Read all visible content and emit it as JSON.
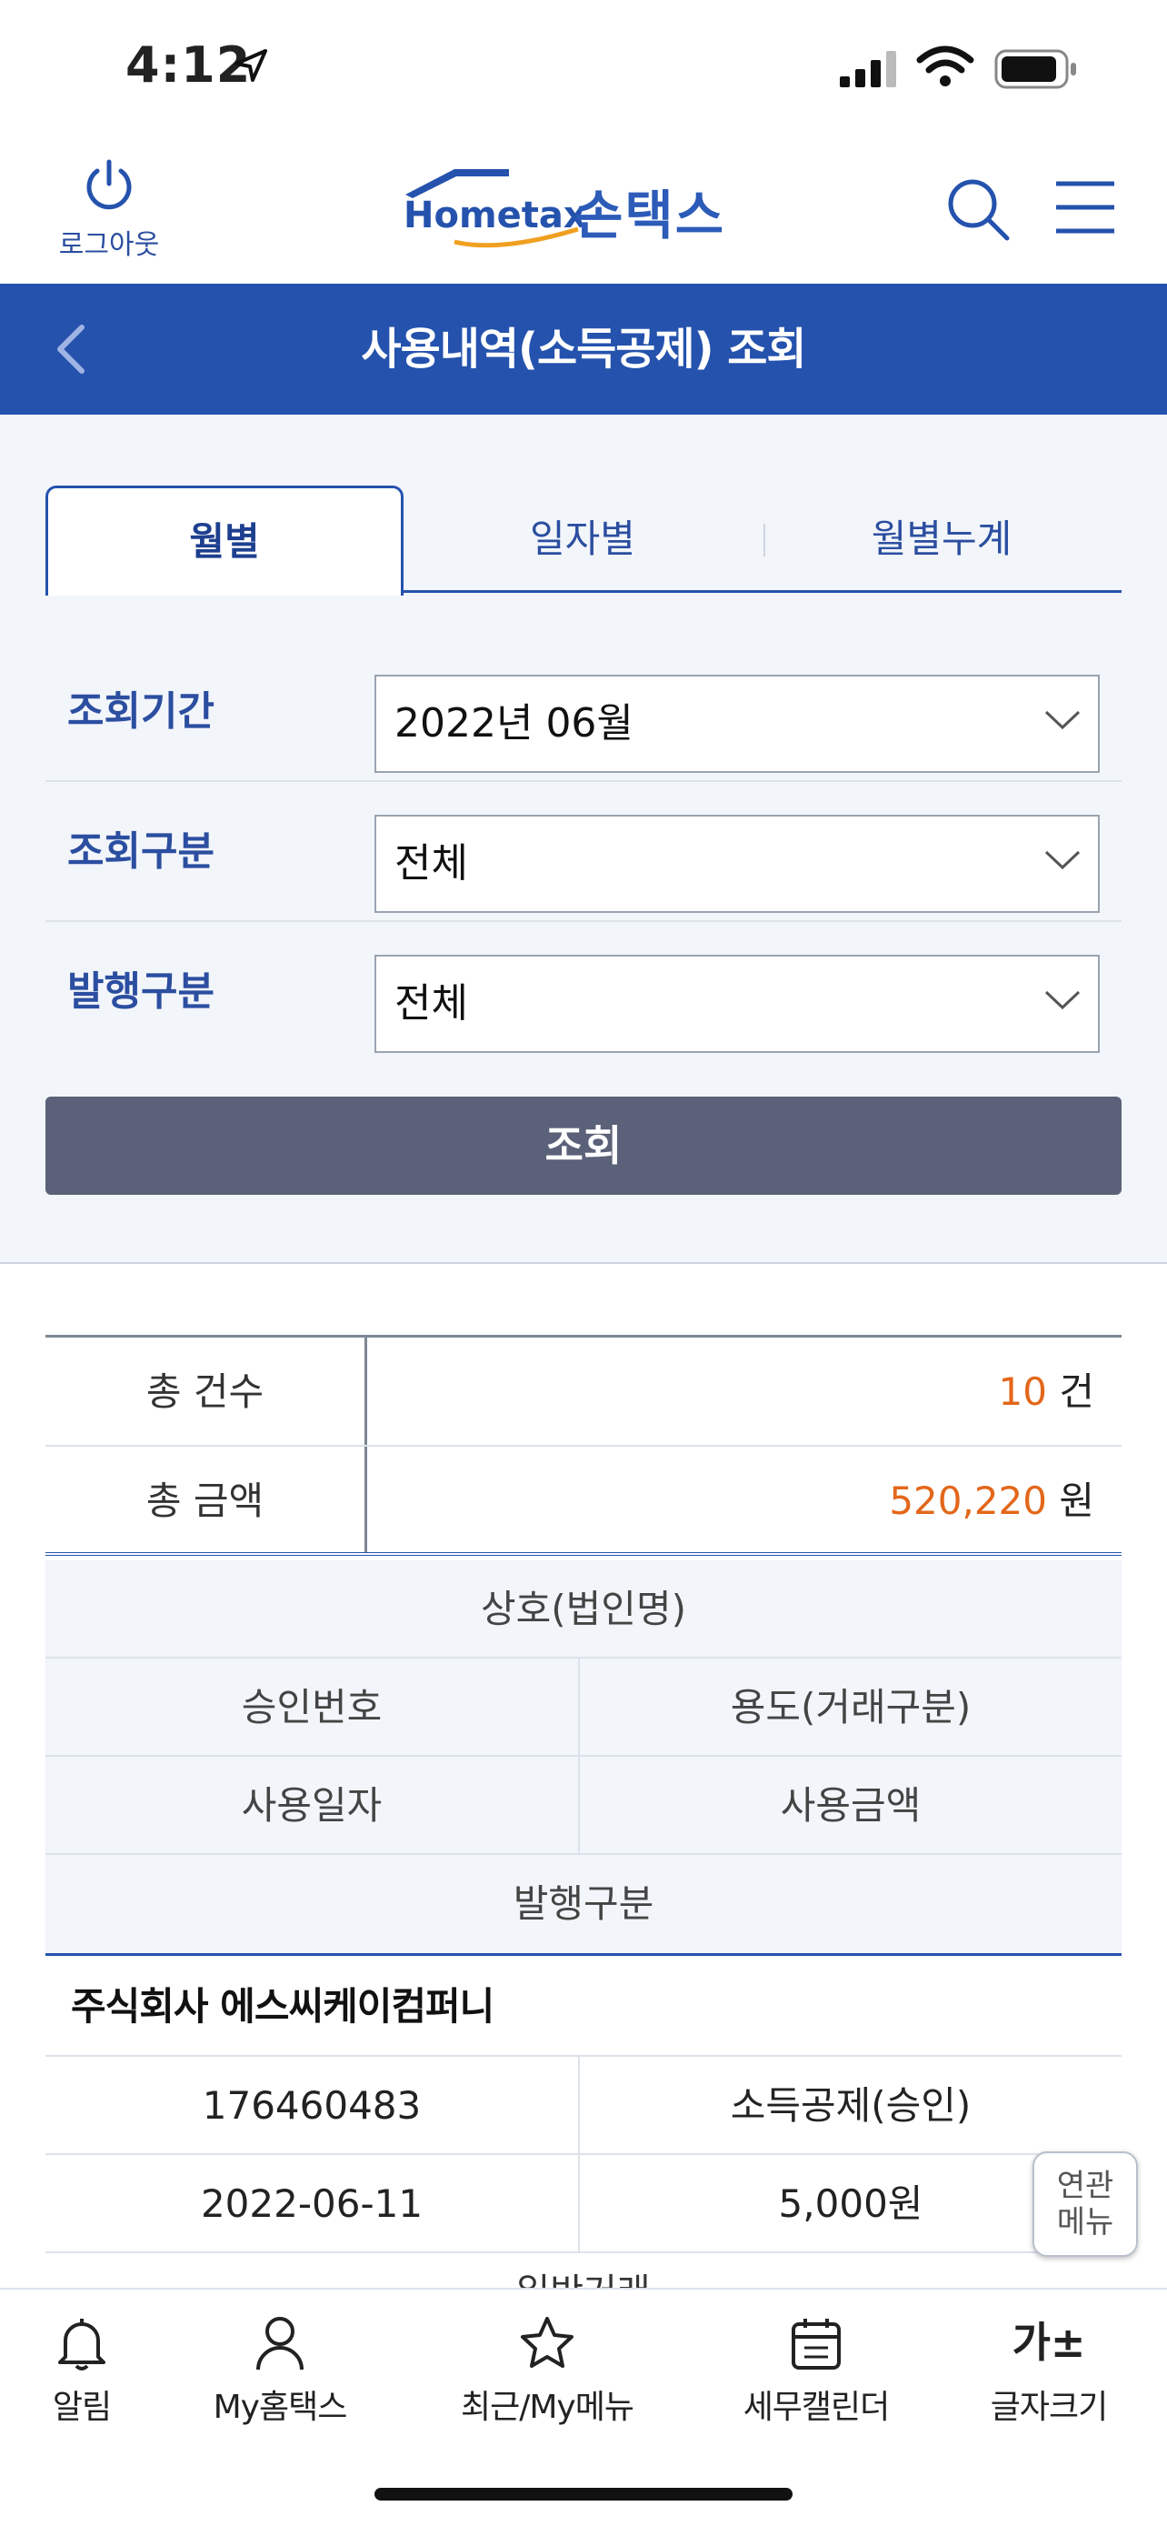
{
  "status_bar": {
    "time": "4:12"
  },
  "header": {
    "logout_label": "로그아웃",
    "logo_text": "손택스",
    "logo_wordmark": "Hometax."
  },
  "title_bar": {
    "title": "사용내역(소득공제) 조회"
  },
  "tabs": [
    {
      "label": "월별",
      "active": true
    },
    {
      "label": "일자별",
      "active": false
    },
    {
      "label": "월별누계",
      "active": false
    }
  ],
  "form": {
    "period": {
      "label": "조회기간",
      "value": "2022년 06월"
    },
    "type": {
      "label": "조회구분",
      "value": "전체"
    },
    "issue": {
      "label": "발행구분",
      "value": "전체"
    },
    "query_button": "조회"
  },
  "summary": {
    "count_label": "총 건수",
    "count_value": "10",
    "count_unit": "건",
    "amount_label": "총 금액",
    "amount_value": "520,220",
    "amount_unit": "원"
  },
  "columns": {
    "merchant": "상호(법인명)",
    "approval_no": "승인번호",
    "usage_type": "용도(거래구분)",
    "date": "사용일자",
    "amount": "사용금액",
    "issue_type": "발행구분"
  },
  "records": [
    {
      "merchant": "주식회사 에스씨케이컴퍼니",
      "approval_no": "176460483",
      "usage_type": "소득공제(승인)",
      "date": "2022-06-11",
      "amount": "5,000원",
      "issue_type_partial": "일반거래"
    }
  ],
  "floating_button": {
    "line1": "연관",
    "line2": "메뉴"
  },
  "bottom_nav": [
    {
      "label": "알림",
      "icon": "bell-icon"
    },
    {
      "label": "My홈택스",
      "icon": "person-icon"
    },
    {
      "label": "최근/My메뉴",
      "icon": "star-icon"
    },
    {
      "label": "세무캘린더",
      "icon": "calendar-icon"
    },
    {
      "label": "글자크기",
      "icon": "font-size-icon",
      "glyph": "가±"
    }
  ],
  "colors": {
    "primary": "#2452ad",
    "accent_orange": "#e3671a",
    "button_gray": "#5a6178"
  }
}
